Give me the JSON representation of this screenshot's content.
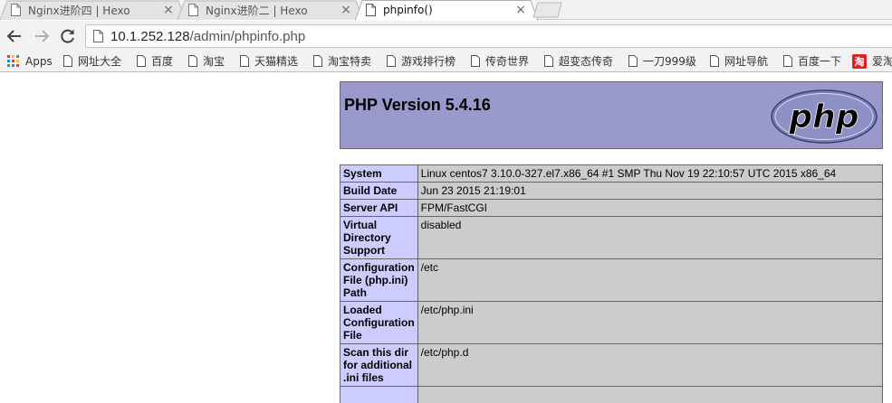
{
  "tabs": [
    {
      "title": "Nginx进阶四 | Hexo",
      "active": false,
      "close": "×"
    },
    {
      "title": "Nginx进阶二 | Hexo",
      "active": false,
      "close": "×"
    },
    {
      "title": "phpinfo()",
      "active": true,
      "close": "×"
    }
  ],
  "toolbar": {
    "url_host": "10.1.252.128",
    "url_path": "/admin/phpinfo.php"
  },
  "bookmarks": [
    {
      "label": "Apps",
      "icon": "apps-grid-icon"
    },
    {
      "label": "网址大全",
      "icon": "page-icon"
    },
    {
      "label": "百度",
      "icon": "page-icon"
    },
    {
      "label": "淘宝",
      "icon": "page-icon"
    },
    {
      "label": "天猫精选",
      "icon": "page-icon"
    },
    {
      "label": "淘宝特卖",
      "icon": "page-icon"
    },
    {
      "label": "游戏排行榜",
      "icon": "page-icon"
    },
    {
      "label": "传奇世界",
      "icon": "page-icon"
    },
    {
      "label": "超变态传奇",
      "icon": "page-icon"
    },
    {
      "label": "一刀999级",
      "icon": "page-icon"
    },
    {
      "label": "网址导航",
      "icon": "page-icon"
    },
    {
      "label": "百度一下",
      "icon": "page-icon"
    },
    {
      "label": "爱淘",
      "icon": "tao-icon"
    }
  ],
  "bookmark_tao_glyph": "淘",
  "php": {
    "version_title": "PHP Version 5.4.16",
    "logo_text": "php",
    "header_color": "#9999cc",
    "key_color": "#ccccff",
    "value_color": "#cccccc",
    "rows": [
      {
        "key": "System",
        "value": "Linux centos7 3.10.0-327.el7.x86_64 #1 SMP Thu Nov 19 22:10:57 UTC 2015 x86_64"
      },
      {
        "key": "Build Date",
        "value": "Jun 23 2015 21:19:01"
      },
      {
        "key": "Server API",
        "value": "FPM/FastCGI"
      },
      {
        "key": "Virtual Directory Support",
        "value": "disabled"
      },
      {
        "key": "Configuration File (php.ini) Path",
        "value": "/etc"
      },
      {
        "key": "Loaded Configuration File",
        "value": "/etc/php.ini"
      },
      {
        "key": "Scan this dir for additional .ini files",
        "value": "/etc/php.d"
      }
    ]
  }
}
